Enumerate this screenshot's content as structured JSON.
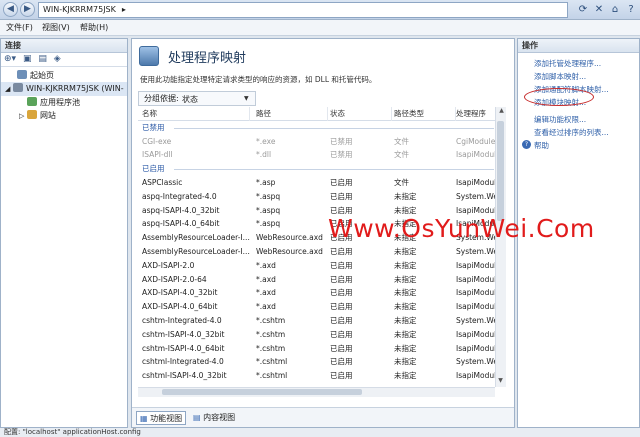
{
  "titlebar": {
    "address": "WIN-KJKRRM75JSK",
    "back_icon": "back-arrow-icon",
    "fwd_icon": "forward-arrow-icon"
  },
  "menubar": {
    "items": [
      "文件(F)",
      "视图(V)",
      "帮助(H)"
    ]
  },
  "left": {
    "header": "连接",
    "tree": [
      "起始页",
      "WIN-KJKRRM75JSK (WIN-",
      "应用程序池",
      "网站"
    ]
  },
  "center": {
    "title": "处理程序映射",
    "description": "使用此功能指定处理特定请求类型的响应的资源，如 DLL 和托管代码。",
    "group_label": "分组依据:",
    "group_value": "状态",
    "columns": [
      "名称",
      "路径",
      "状态",
      "路径类型",
      "处理程序"
    ],
    "groups": {
      "disabled": "已禁用",
      "enabled": "已启用"
    },
    "disabled_rows": [
      [
        "CGI-exe",
        "*.exe",
        "已禁用",
        "文件",
        "CgiModule"
      ],
      [
        "ISAPI-dll",
        "*.dll",
        "已禁用",
        "文件",
        "IsapiModule"
      ]
    ],
    "enabled_rows": [
      [
        "ASPClassic",
        "*.asp",
        "已启用",
        "文件",
        "IsapiModule"
      ],
      [
        "aspq-Integrated-4.0",
        "*.aspq",
        "已启用",
        "未指定",
        "System.Web"
      ],
      [
        "aspq-ISAPI-4.0_32bit",
        "*.aspq",
        "已启用",
        "未指定",
        "IsapiModule"
      ],
      [
        "aspq-ISAPI-4.0_64bit",
        "*.aspq",
        "已启用",
        "未指定",
        "IsapiModule"
      ],
      [
        "AssemblyResourceLoader-I...",
        "WebResource.axd",
        "已启用",
        "未指定",
        "System.Web"
      ],
      [
        "AssemblyResourceLoader-I...",
        "WebResource.axd",
        "已启用",
        "未指定",
        "System.Web"
      ],
      [
        "AXD-ISAPI-2.0",
        "*.axd",
        "已启用",
        "未指定",
        "IsapiModule"
      ],
      [
        "AXD-ISAPI-2.0-64",
        "*.axd",
        "已启用",
        "未指定",
        "IsapiModule"
      ],
      [
        "AXD-ISAPI-4.0_32bit",
        "*.axd",
        "已启用",
        "未指定",
        "IsapiModule"
      ],
      [
        "AXD-ISAPI-4.0_64bit",
        "*.axd",
        "已启用",
        "未指定",
        "IsapiModule"
      ],
      [
        "cshtm-Integrated-4.0",
        "*.cshtm",
        "已启用",
        "未指定",
        "System.Web"
      ],
      [
        "cshtm-ISAPI-4.0_32bit",
        "*.cshtm",
        "已启用",
        "未指定",
        "IsapiModule"
      ],
      [
        "cshtm-ISAPI-4.0_64bit",
        "*.cshtm",
        "已启用",
        "未指定",
        "IsapiModule"
      ],
      [
        "cshtml-Integrated-4.0",
        "*.cshtml",
        "已启用",
        "未指定",
        "System.Web"
      ],
      [
        "cshtml-ISAPI-4.0_32bit",
        "*.cshtml",
        "已启用",
        "未指定",
        "IsapiModule"
      ]
    ],
    "tabs": [
      "功能视图",
      "内容视图"
    ]
  },
  "right": {
    "header": "操作",
    "actions": [
      "添加托管处理程序...",
      "添加脚本映射...",
      "添加通配符脚本映射...",
      "添加模块映射...",
      "编辑功能权限...",
      "查看经过排序的列表..."
    ],
    "help": "帮助"
  },
  "status": "配置: \"localhost\" applicationHost.config",
  "watermark": "Www.OsYunWei.Com",
  "colors": {
    "accent": "#2e5fa8",
    "highlight_circle": "#c72c2c",
    "watermark": "#e11b1b"
  }
}
